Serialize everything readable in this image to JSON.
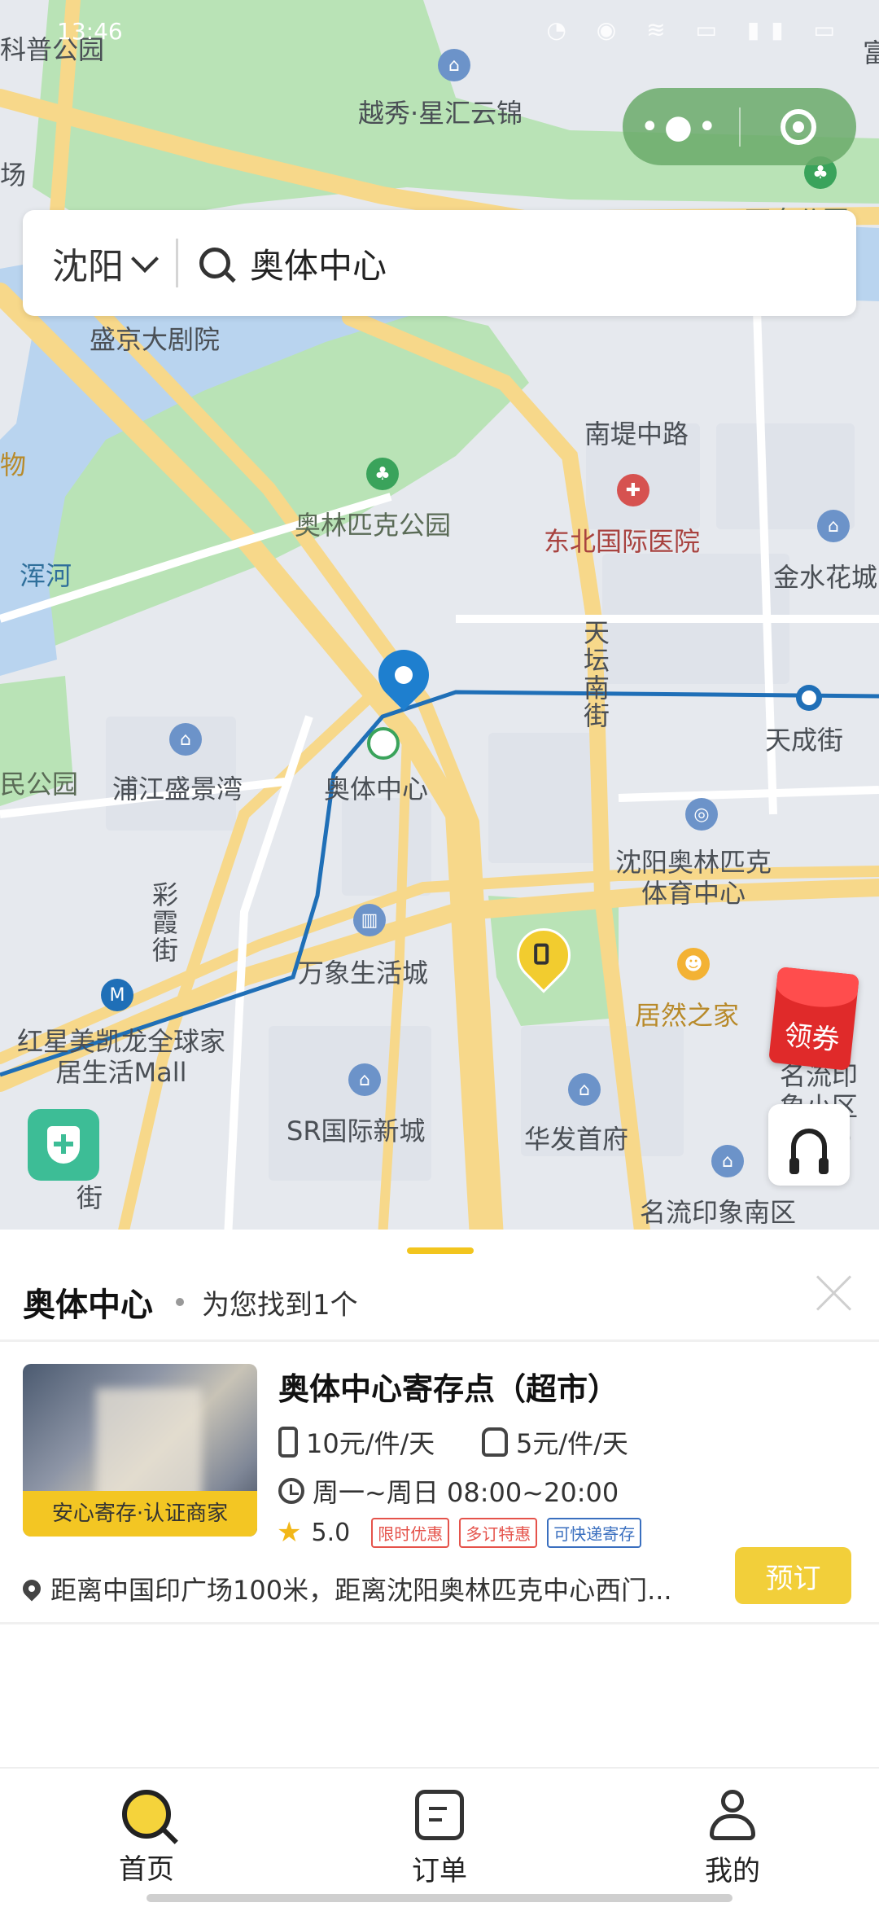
{
  "status_bar": {
    "time": "13:46"
  },
  "search": {
    "city": "沈阳",
    "query": "奥体中心"
  },
  "map_labels": {
    "kepu": "科普公园",
    "xinghui": "越秀·星汇云锦",
    "chang": "场",
    "wanquan": "万泉公园",
    "shengjing": "盛京大剧院",
    "nandi": "南堤中路",
    "dongbei": "东北国际医院",
    "aolinpike_park": "奥林匹克公园",
    "hunhe": "浑河",
    "jinshui": "金水花城",
    "wu": "物",
    "tiantan": "天坛南街",
    "tiancheng": "天成街",
    "min_park": "民公园",
    "pujiang": "浦江盛景湾",
    "aoti": "奥体中心",
    "sy_aolinpike": "沈阳奥林匹克体育中心",
    "caixia": "彩霞街",
    "wanxiang": "万象生活城",
    "juran": "居然之家",
    "hongxing": "红星美凯龙全球家居生活Mall",
    "mingliu_dong": "名流印象小区(东区)",
    "sr": "SR国际新城",
    "huafa": "华发首府",
    "mingliu_nan": "名流印象南区",
    "jie": "街",
    "fu": "富"
  },
  "coupon_label": "领券",
  "results": {
    "keyword": "奥体中心",
    "count_text": "为您找到1个"
  },
  "store": {
    "name": "奥体中心寄存点（超市）",
    "badge": "安心寄存·认证商家",
    "price_small": "10元/件/天",
    "price_large": "5元/件/天",
    "hours": "周一~周日 08:00~20:00",
    "rating": "5.0",
    "tags": [
      "限时优惠",
      "多订特惠",
      "可快递寄存"
    ],
    "address": "距离中国印广场100米，距离沈阳奥林匹克中心西门...",
    "book_label": "预订"
  },
  "tabbar": [
    {
      "label": "首页",
      "icon": "home-search-icon",
      "active": true
    },
    {
      "label": "订单",
      "icon": "order-icon",
      "active": false
    },
    {
      "label": "我的",
      "icon": "profile-icon",
      "active": false
    }
  ],
  "colors": {
    "accent": "#f2cf3a",
    "map_water": "#b9d4ef",
    "map_park": "#b9e3b6",
    "map_road": "#f7d88a"
  }
}
